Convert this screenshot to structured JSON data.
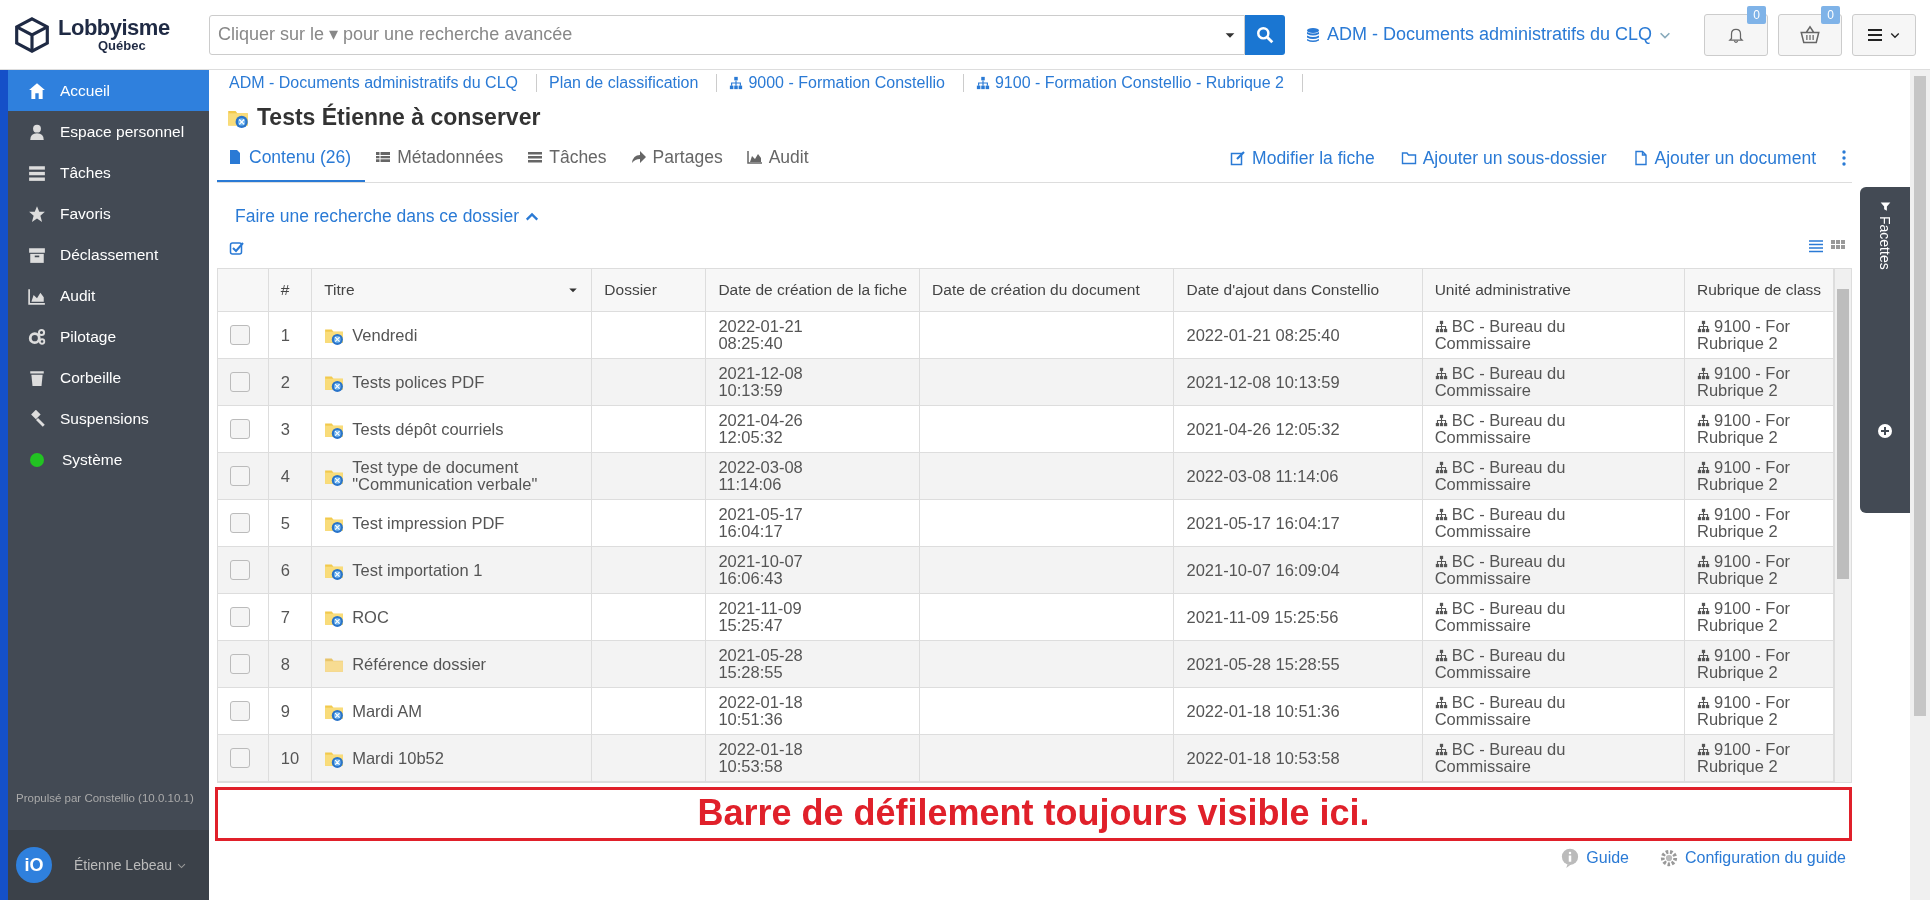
{
  "header": {
    "logo_name": "Lobbyisme",
    "logo_sub": "Québec",
    "search_placeholder": "Cliquer sur le ▾ pour une recherche avancée",
    "collection": "ADM - Documents administratifs du CLQ",
    "notifications_count": "0",
    "basket_count": "0"
  },
  "sidebar": {
    "items": [
      {
        "label": "Accueil",
        "selected": true
      },
      {
        "label": "Espace personnel",
        "selected": false
      },
      {
        "label": "Tâches",
        "selected": false
      },
      {
        "label": "Favoris",
        "selected": false
      },
      {
        "label": "Déclassement",
        "selected": false
      },
      {
        "label": "Audit",
        "selected": false
      },
      {
        "label": "Pilotage",
        "selected": false
      },
      {
        "label": "Corbeille",
        "selected": false
      },
      {
        "label": "Suspensions",
        "selected": false
      },
      {
        "label": "Système",
        "selected": false,
        "color": "#22c322"
      }
    ],
    "footer": "Propulsé par Constellio (10.0.10.1)",
    "user": {
      "avatar": "iO",
      "name": "Étienne Lebeau"
    }
  },
  "breadcrumb": [
    {
      "label": "ADM - Documents administratifs du CLQ",
      "kind": "plain"
    },
    {
      "label": "Plan de classification",
      "kind": "plain"
    },
    {
      "label": "9000 - Formation Constellio",
      "kind": "category"
    },
    {
      "label": "9100 - Formation Constellio - Rubrique 2",
      "kind": "category"
    }
  ],
  "title": "Tests Étienne à conserver",
  "tabs": [
    {
      "label": "Contenu (26)",
      "selected": true
    },
    {
      "label": "Métadonnées",
      "selected": false
    },
    {
      "label": "Tâches",
      "selected": false
    },
    {
      "label": "Partages",
      "selected": false
    },
    {
      "label": "Audit",
      "selected": false
    }
  ],
  "actions": [
    "Modifier la fiche",
    "Ajouter un sous-dossier",
    "Ajouter un document"
  ],
  "folder_search": "Faire une recherche dans ce dossier",
  "views": [
    {
      "selected": true
    },
    {
      "selected": false
    }
  ],
  "facets_label": "Facettes",
  "table": {
    "columns": [
      "#",
      "Titre",
      "Dossier",
      "Date de création de la fiche",
      "Date de création du document",
      "Date d'ajout dans Constellio",
      "Unité administrative",
      "Rubrique de class"
    ],
    "rows": [
      {
        "checked": false,
        "number": "1",
        "kind": "shared",
        "title": "Vendredi",
        "created_date": "2022-01-21",
        "created_time": "08:25:40",
        "added": "2022-01-21 08:25:40",
        "unit": [
          "BC - Bureau du",
          "Commissaire"
        ],
        "category": [
          "9100 - For",
          "Rubrique 2"
        ]
      },
      {
        "checked": false,
        "number": "2",
        "kind": "shared",
        "title": "Tests polices PDF",
        "created_date": "2021-12-08",
        "created_time": "10:13:59",
        "added": "2021-12-08 10:13:59",
        "unit": [
          "BC - Bureau du",
          "Commissaire"
        ],
        "category": [
          "9100 - For",
          "Rubrique 2"
        ]
      },
      {
        "checked": false,
        "number": "3",
        "kind": "shared",
        "title": "Tests dépôt courriels",
        "created_date": "2021-04-26",
        "created_time": "12:05:32",
        "added": "2021-04-26 12:05:32",
        "unit": [
          "BC - Bureau du",
          "Commissaire"
        ],
        "category": [
          "9100 - For",
          "Rubrique 2"
        ]
      },
      {
        "checked": false,
        "number": "4",
        "kind": "shared",
        "title": "Test type de document \"Communication verbale\"",
        "created_date": "2022-03-08",
        "created_time": "11:14:06",
        "added": "2022-03-08 11:14:06",
        "unit": [
          "BC - Bureau du",
          "Commissaire"
        ],
        "category": [
          "9100 - For",
          "Rubrique 2"
        ]
      },
      {
        "checked": false,
        "number": "5",
        "kind": "shared",
        "title": "Test impression PDF",
        "created_date": "2021-05-17",
        "created_time": "16:04:17",
        "added": "2021-05-17 16:04:17",
        "unit": [
          "BC - Bureau du",
          "Commissaire"
        ],
        "category": [
          "9100 - For",
          "Rubrique 2"
        ]
      },
      {
        "checked": false,
        "number": "6",
        "kind": "shared",
        "title": "Test importation 1",
        "created_date": "2021-10-07",
        "created_time": "16:06:43",
        "added": "2021-10-07 16:09:04",
        "unit": [
          "BC - Bureau du",
          "Commissaire"
        ],
        "category": [
          "9100 - For",
          "Rubrique 2"
        ]
      },
      {
        "checked": false,
        "number": "7",
        "kind": "shared",
        "title": "ROC",
        "created_date": "2021-11-09",
        "created_time": "15:25:47",
        "added": "2021-11-09 15:25:56",
        "unit": [
          "BC - Bureau du",
          "Commissaire"
        ],
        "category": [
          "9100 - For",
          "Rubrique 2"
        ]
      },
      {
        "checked": false,
        "number": "8",
        "kind": "plain",
        "title": "Référence dossier",
        "created_date": "2021-05-28",
        "created_time": "15:28:55",
        "added": "2021-05-28 15:28:55",
        "unit": [
          "BC - Bureau du",
          "Commissaire"
        ],
        "category": [
          "9100 - For",
          "Rubrique 2"
        ]
      },
      {
        "checked": false,
        "number": "9",
        "kind": "shared",
        "title": "Mardi AM",
        "created_date": "2022-01-18",
        "created_time": "10:51:36",
        "added": "2022-01-18 10:51:36",
        "unit": [
          "BC - Bureau du",
          "Commissaire"
        ],
        "category": [
          "9100 - For",
          "Rubrique 2"
        ]
      },
      {
        "checked": false,
        "number": "10",
        "kind": "shared",
        "title": "Mardi 10b52",
        "created_date": "2022-01-18",
        "created_time": "10:53:58",
        "added": "2022-01-18 10:53:58",
        "unit": [
          "BC - Bureau du",
          "Commissaire"
        ],
        "category": [
          "9100 - For",
          "Rubrique 2"
        ]
      }
    ]
  },
  "annotation": "Barre de défilement toujours visible ici.",
  "footer_links": [
    "Guide",
    "Configuration du guide"
  ]
}
